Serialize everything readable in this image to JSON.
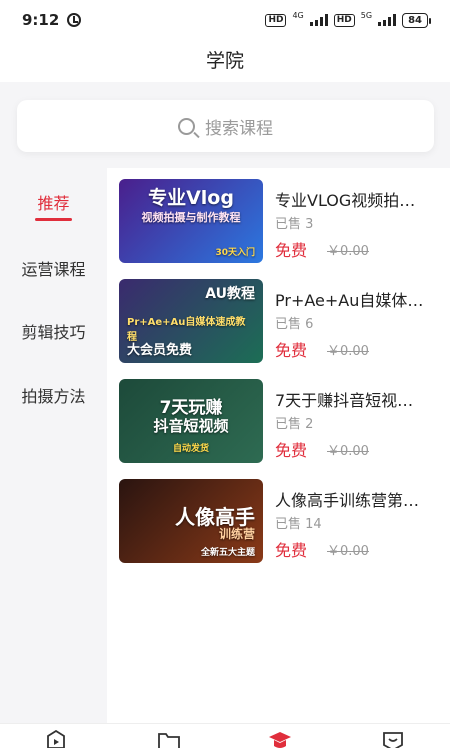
{
  "status_bar": {
    "time": "9:12",
    "hd1": "HD",
    "net1": "4G",
    "hd2": "HD",
    "net2": "5G",
    "battery": "84"
  },
  "header": {
    "title": "学院"
  },
  "search": {
    "placeholder": "搜索课程"
  },
  "sidebar": {
    "items": [
      {
        "label": "推荐",
        "active": true
      },
      {
        "label": "运营课程",
        "active": false
      },
      {
        "label": "剪辑技巧",
        "active": false
      },
      {
        "label": "拍摄方法",
        "active": false
      }
    ]
  },
  "courses": [
    {
      "title": "专业VLOG视频拍…",
      "sold": "已售 3",
      "price": "免费",
      "original_price": "￥0.00",
      "thumb_line1": "专业Vlog",
      "thumb_line2": "视频拍摄与制作教程",
      "thumb_line3": "30天入门",
      "thumb_colors": [
        "#4a1f8c",
        "#2b78e0"
      ]
    },
    {
      "title": "Pr+Ae+Au自媒体…",
      "sold": "已售 6",
      "price": "免费",
      "original_price": "￥0.00",
      "thumb_line1": "AU教程",
      "thumb_line2": "Pr+Ae+Au自媒体速成教程",
      "thumb_line3": "大会员免费",
      "thumb_colors": [
        "#3a2a6e",
        "#1c6e55"
      ]
    },
    {
      "title": "7天于赚抖音短视…",
      "sold": "已售 2",
      "price": "免费",
      "original_price": "￥0.00",
      "thumb_line1": "7天玩赚",
      "thumb_line2": "抖音短视频",
      "thumb_line3": "自动发货",
      "thumb_colors": [
        "#1d4a3a",
        "#2e6b52"
      ]
    },
    {
      "title": "人像高手训练营第…",
      "sold": "已售 14",
      "price": "免费",
      "original_price": "￥0.00",
      "thumb_line1": "人像高手",
      "thumb_line2": "训练营",
      "thumb_line3": "全新五大主题",
      "thumb_colors": [
        "#2a1410",
        "#8a3a18"
      ]
    }
  ],
  "tabbar": {
    "icons": [
      "play-icon",
      "folder-icon",
      "graduation-cap-icon",
      "chat-icon"
    ],
    "accent": "#e02e3c"
  }
}
